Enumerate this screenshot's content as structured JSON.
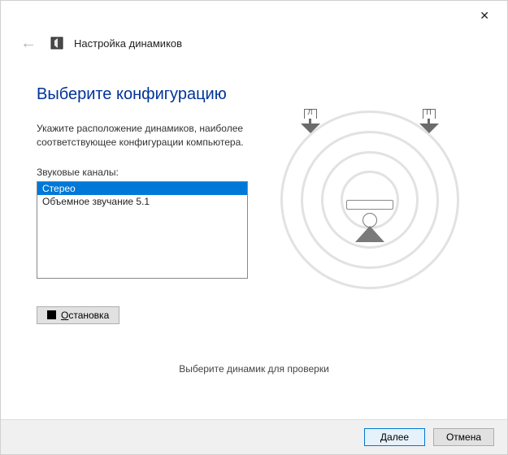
{
  "window": {
    "title": "Настройка динамиков"
  },
  "main": {
    "heading": "Выберите конфигурацию",
    "instruction": "Укажите расположение динамиков, наиболее соответствующее конфигурации компьютера.",
    "audio_channels_label": "Звуковые каналы:",
    "channel_options": [
      {
        "label": "Стерео",
        "selected": true
      },
      {
        "label": "Объемное звучание 5.1",
        "selected": false
      }
    ],
    "stop_label": "Остановка",
    "hint": "Выберите динамик для проверки"
  },
  "diagram": {
    "left_speaker_tag": "Л",
    "right_speaker_tag": "П"
  },
  "buttons": {
    "next": "Далее",
    "cancel": "Отмена"
  }
}
